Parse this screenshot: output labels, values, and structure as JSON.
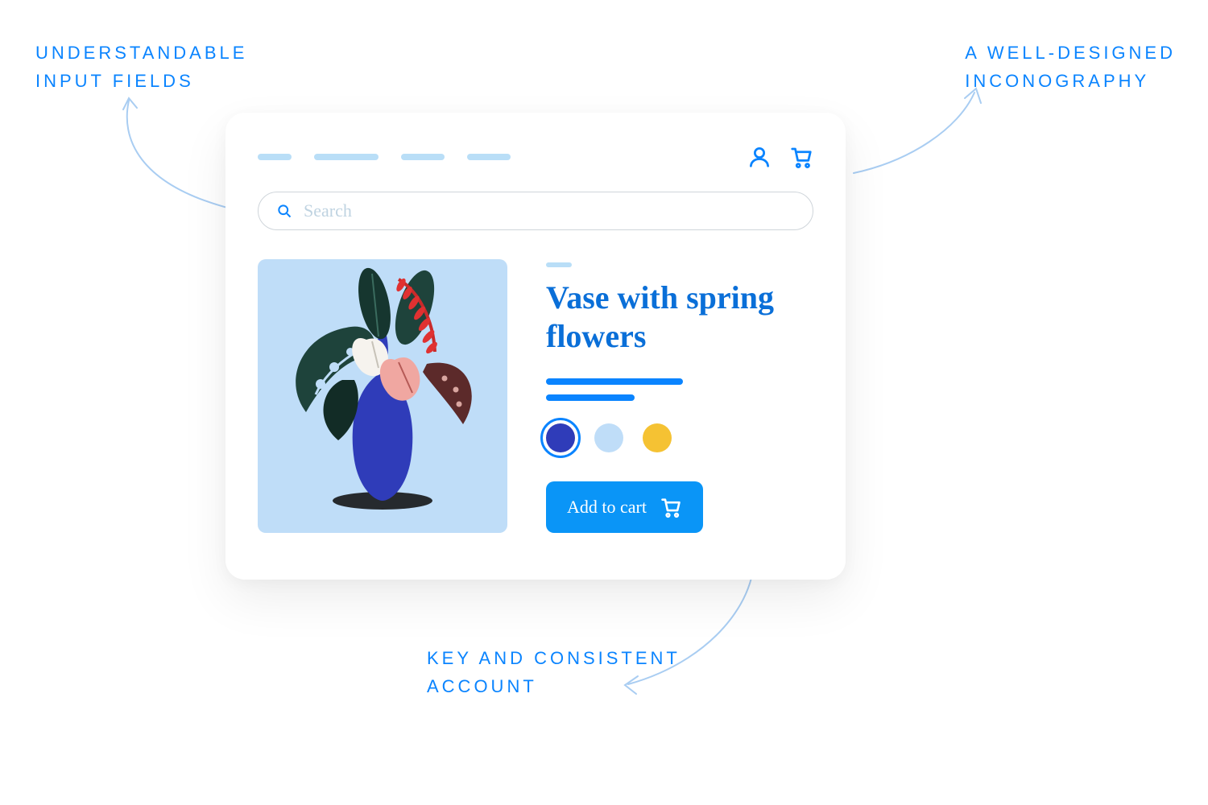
{
  "annotations": {
    "top_left_l1": "UNDERSTANDABLE",
    "top_left_l2": "INPUT FIELDS",
    "top_right_l1": "A WELL-DESIGNED",
    "top_right_l2": "INCONOGRAPHY",
    "bottom_l1": "KEY AND CONSISTENT",
    "bottom_l2": "ACCOUNT"
  },
  "search": {
    "placeholder": "Search"
  },
  "product": {
    "title": "Vase with spring flowers",
    "cta": "Add to cart",
    "swatches": {
      "selected": "#2f3cb9",
      "option2": "#bfddf8",
      "option3": "#f5c233"
    }
  },
  "colors": {
    "accent": "#0a84ff",
    "image_bg": "#bfddf8"
  }
}
